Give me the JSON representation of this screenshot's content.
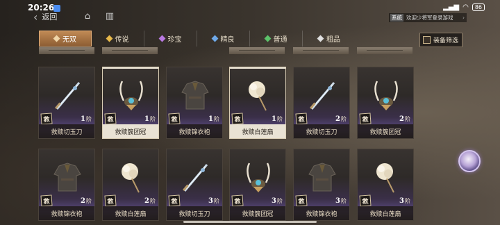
{
  "status_bar": {
    "time": "20:26",
    "battery": "86"
  },
  "nav": {
    "back_label": "返回"
  },
  "system_message": {
    "tag": "系统",
    "text": "欢迎少将军登录游戏"
  },
  "filters": [
    {
      "label": "无双",
      "color": "#f0d6a8",
      "active": true
    },
    {
      "label": "传说",
      "color": "#e7b94a",
      "active": false
    },
    {
      "label": "珍宝",
      "color": "#b878e0",
      "active": false
    },
    {
      "label": "精良",
      "color": "#6ea8e8",
      "active": false
    },
    {
      "label": "普通",
      "color": "#5cc26a",
      "active": false
    },
    {
      "label": "粗品",
      "color": "#e0e0e0",
      "active": false
    }
  ],
  "equip_filter_label": "装备筛选",
  "badge_char": "救",
  "tier_suffix": "阶",
  "items_row1": [
    {
      "name": "救赎切玉刀",
      "tier": "1",
      "icon": "sword-icon",
      "selected": false
    },
    {
      "name": "救赎簇团冠",
      "tier": "1",
      "icon": "crown-icon",
      "selected": true
    },
    {
      "name": "救赎锦衣袍",
      "tier": "1",
      "icon": "robe-icon",
      "selected": false
    },
    {
      "name": "救赎白莲扇",
      "tier": "1",
      "icon": "fan-icon",
      "selected": true
    },
    {
      "name": "救赎切玉刀",
      "tier": "2",
      "icon": "sword-icon",
      "selected": false
    },
    {
      "name": "救赎簇团冠",
      "tier": "2",
      "icon": "crown-icon",
      "selected": false
    }
  ],
  "items_row2": [
    {
      "name": "救赎锦衣袍",
      "tier": "2",
      "icon": "robe-icon",
      "selected": false
    },
    {
      "name": "救赎白莲扇",
      "tier": "2",
      "icon": "fan-icon",
      "selected": false
    },
    {
      "name": "救赎切玉刀",
      "tier": "3",
      "icon": "sword-icon",
      "selected": false
    },
    {
      "name": "救赎簇团冠",
      "tier": "3",
      "icon": "crown-icon",
      "selected": false
    },
    {
      "name": "救赎锦衣袍",
      "tier": "3",
      "icon": "robe-icon",
      "selected": false
    },
    {
      "name": "救赎白莲扇",
      "tier": "3",
      "icon": "fan-icon",
      "selected": false
    }
  ]
}
